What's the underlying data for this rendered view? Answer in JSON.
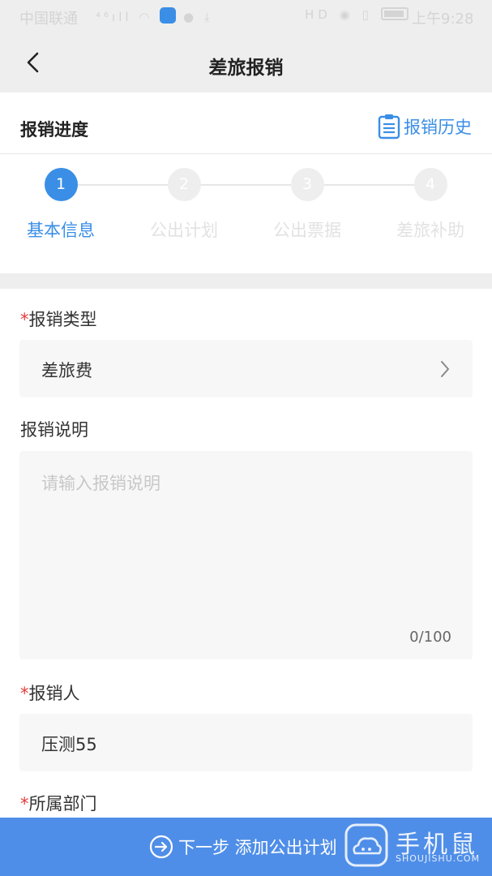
{
  "status_bar": {
    "carrier": "中国联通",
    "signal_indicator": "⁴⁶ıll",
    "time": "上午9:28",
    "hd_label": "HD",
    "icons": [
      "signal-icon",
      "wifi-icon",
      "app-badge-icon",
      "chat-icon",
      "download-icon",
      "eye-icon",
      "vibrate-icon",
      "battery-icon"
    ]
  },
  "header": {
    "title": "差旅报销",
    "back_icon": "chevron-left-icon"
  },
  "progress": {
    "label": "报销进度",
    "history_label": "报销历史",
    "history_icon": "clipboard-list-icon"
  },
  "steps": [
    {
      "number": "1",
      "label": "基本信息",
      "active": true
    },
    {
      "number": "2",
      "label": "公出计划",
      "active": false
    },
    {
      "number": "3",
      "label": "公出票据",
      "active": false
    },
    {
      "number": "4",
      "label": "差旅补助",
      "active": false
    }
  ],
  "form": {
    "type_label": "报销类型",
    "type_value": "差旅费",
    "desc_label": "报销说明",
    "desc_placeholder": "请输入报销说明",
    "desc_counter": "0/100",
    "person_label": "报销人",
    "person_value": "压测55",
    "dept_label": "所属部门",
    "required_mark": "*"
  },
  "footer": {
    "next_label": "下一步 添加公出计划",
    "next_icon": "arrow-right-circle-icon"
  },
  "watermark": {
    "title": "手机鼠",
    "subtitle": "SHOUJISHU.COM"
  },
  "colors": {
    "accent": "#3a8ee6",
    "button": "#4f8ee8",
    "required": "#e53b3b",
    "band": "#eeeeee"
  }
}
